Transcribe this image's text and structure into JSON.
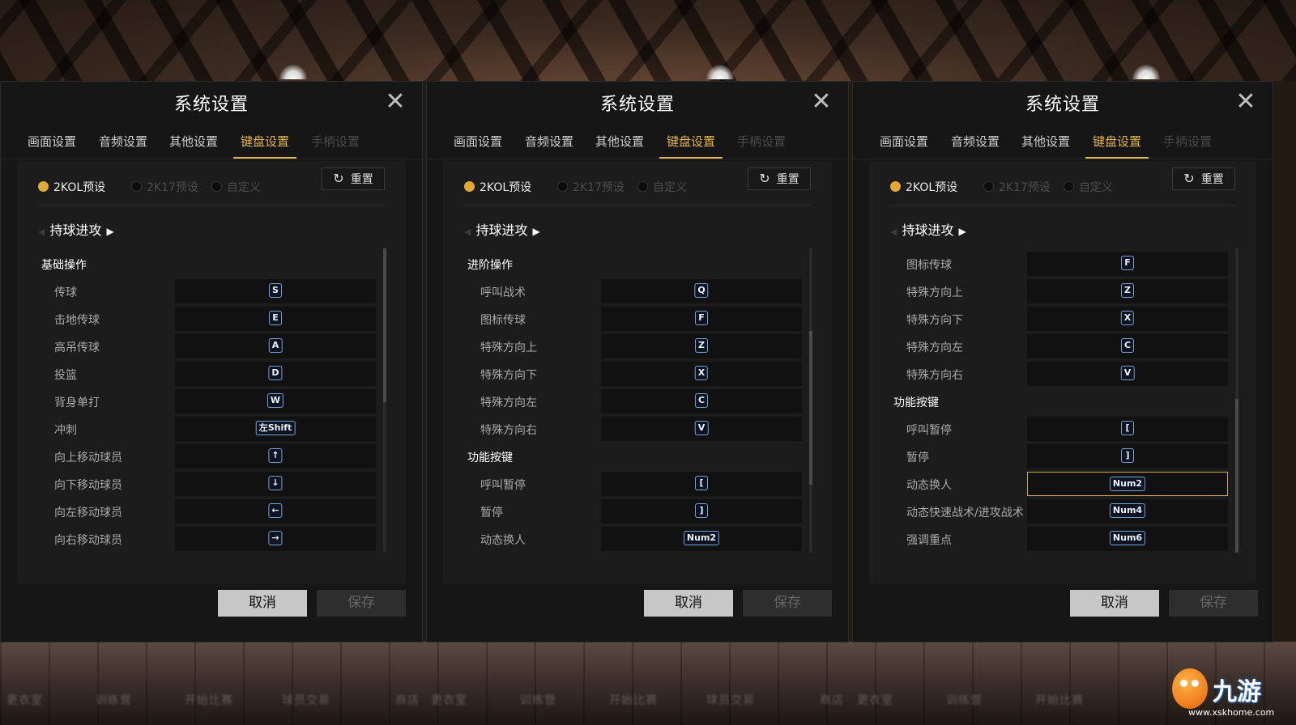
{
  "bg_labels": [
    "更衣室",
    "训练营",
    "开始比赛",
    "球员交易",
    "商店"
  ],
  "panels": [
    {
      "title": "系统设置",
      "tabs": [
        "画面设置",
        "音频设置",
        "其他设置",
        "键盘设置",
        "手柄设置"
      ],
      "active_tab": "键盘设置",
      "presets": [
        "2KOL预设",
        "2K17预设",
        "自定义"
      ],
      "selected_preset": "2KOL预设",
      "reset_label": "重置",
      "section": "持球进攻",
      "rows": [
        {
          "type": "group",
          "label": "基础操作"
        },
        {
          "type": "key",
          "label": "传球",
          "key": "S"
        },
        {
          "type": "key",
          "label": "击地传球",
          "key": "E"
        },
        {
          "type": "key",
          "label": "高吊传球",
          "key": "A"
        },
        {
          "type": "key",
          "label": "投篮",
          "key": "D"
        },
        {
          "type": "key",
          "label": "背身单打",
          "key": "W"
        },
        {
          "type": "key",
          "label": "冲刺",
          "key": "左Shift"
        },
        {
          "type": "key",
          "label": "向上移动球员",
          "key": "↑"
        },
        {
          "type": "key",
          "label": "向下移动球员",
          "key": "↓"
        },
        {
          "type": "key",
          "label": "向左移动球员",
          "key": "←"
        },
        {
          "type": "key",
          "label": "向右移动球员",
          "key": "→"
        }
      ],
      "scroll_position": 0.0,
      "cancel_label": "取消",
      "save_label": "保存"
    },
    {
      "title": "系统设置",
      "tabs": [
        "画面设置",
        "音频设置",
        "其他设置",
        "键盘设置",
        "手柄设置"
      ],
      "active_tab": "键盘设置",
      "presets": [
        "2KOL预设",
        "2K17预设",
        "自定义"
      ],
      "selected_preset": "2KOL预设",
      "reset_label": "重置",
      "section": "持球进攻",
      "rows": [
        {
          "type": "group",
          "label": "进阶操作"
        },
        {
          "type": "key",
          "label": "呼叫战术",
          "key": "Q"
        },
        {
          "type": "key",
          "label": "图标传球",
          "key": "F"
        },
        {
          "type": "key",
          "label": "特殊方向上",
          "key": "Z"
        },
        {
          "type": "key",
          "label": "特殊方向下",
          "key": "X"
        },
        {
          "type": "key",
          "label": "特殊方向左",
          "key": "C"
        },
        {
          "type": "key",
          "label": "特殊方向右",
          "key": "V"
        },
        {
          "type": "group",
          "label": "功能按键"
        },
        {
          "type": "key",
          "label": "呼叫暂停",
          "key": "["
        },
        {
          "type": "key",
          "label": "暂停",
          "key": "]"
        },
        {
          "type": "key",
          "label": "动态换人",
          "key": "Num2"
        }
      ],
      "scroll_position": 0.55,
      "cancel_label": "取消",
      "save_label": "保存"
    },
    {
      "title": "系统设置",
      "tabs": [
        "画面设置",
        "音频设置",
        "其他设置",
        "键盘设置",
        "手柄设置"
      ],
      "active_tab": "键盘设置",
      "presets": [
        "2KOL预设",
        "2K17预设",
        "自定义"
      ],
      "selected_preset": "2KOL预设",
      "reset_label": "重置",
      "section": "持球进攻",
      "rows": [
        {
          "type": "key",
          "label": "图标传球",
          "key": "F"
        },
        {
          "type": "key",
          "label": "特殊方向上",
          "key": "Z"
        },
        {
          "type": "key",
          "label": "特殊方向下",
          "key": "X"
        },
        {
          "type": "key",
          "label": "特殊方向左",
          "key": "C"
        },
        {
          "type": "key",
          "label": "特殊方向右",
          "key": "V"
        },
        {
          "type": "group",
          "label": "功能按键"
        },
        {
          "type": "key",
          "label": "呼叫暂停",
          "key": "["
        },
        {
          "type": "key",
          "label": "暂停",
          "key": "]"
        },
        {
          "type": "key",
          "label": "动态换人",
          "key": "Num2",
          "highlighted": true
        },
        {
          "type": "key",
          "label": "动态快速战术/进攻战术",
          "key": "Num4"
        },
        {
          "type": "key",
          "label": "强调重点",
          "key": "Num6"
        }
      ],
      "scroll_position": 1.0,
      "cancel_label": "取消",
      "save_label": "保存"
    }
  ],
  "logo": {
    "word": "九游",
    "url": "www.xskhome.com"
  },
  "colors": {
    "accent": "#e2b64d",
    "key_border": "#6fa3d9",
    "panel_bg": "#161616"
  }
}
